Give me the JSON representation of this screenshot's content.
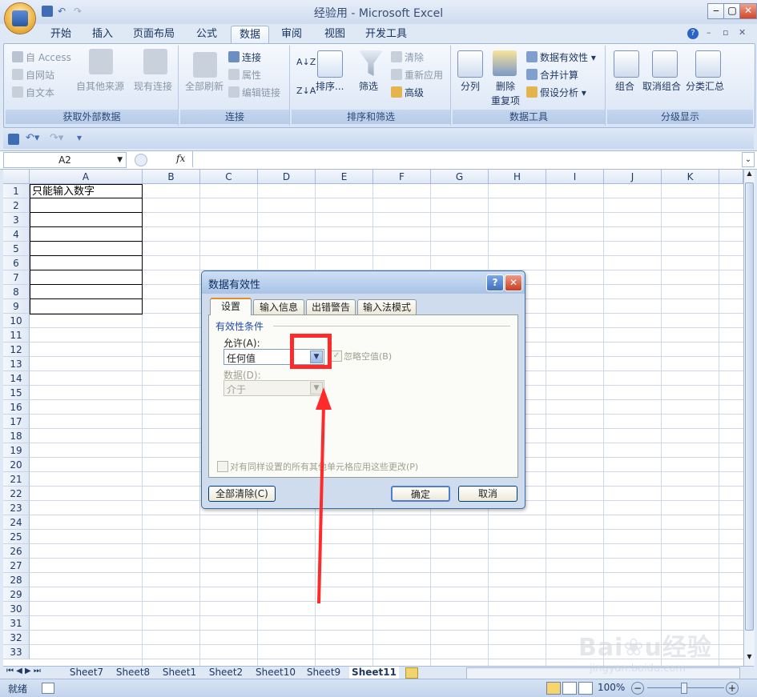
{
  "window": {
    "title": "经验用 - Microsoft Excel"
  },
  "tabs": [
    "开始",
    "插入",
    "页面布局",
    "公式",
    "数据",
    "审阅",
    "视图",
    "开发工具"
  ],
  "active_tab": "数据",
  "ribbon": {
    "get_external": {
      "access": "自 Access",
      "web": "自网站",
      "text": "自文本",
      "other": "自其他来源",
      "existing": "现有连接",
      "label": "获取外部数据"
    },
    "connections": {
      "refresh": "全部刷新",
      "connect": "连接",
      "props": "属性",
      "edit_links": "编辑链接",
      "label": "连接"
    },
    "sort_filter": {
      "sort": "排序...",
      "filter": "筛选",
      "clear": "清除",
      "reapply": "重新应用",
      "advanced": "高级",
      "label": "排序和筛选"
    },
    "data_tools": {
      "split": "分列",
      "remove_dup_1": "删除",
      "remove_dup_2": "重复项",
      "validation": "数据有效性",
      "consolidate": "合并计算",
      "whatif": "假设分析",
      "label": "数据工具"
    },
    "outline": {
      "group": "组合",
      "ungroup": "取消组合",
      "subtotal": "分类汇总",
      "label": "分级显示"
    }
  },
  "formula_bar": {
    "name_box": "A2",
    "fx": "fx"
  },
  "columns": [
    "A",
    "B",
    "C",
    "D",
    "E",
    "F",
    "G",
    "H",
    "I",
    "J",
    "K"
  ],
  "rows": [
    "1",
    "2",
    "3",
    "4",
    "5",
    "6",
    "7",
    "8",
    "9",
    "10",
    "11",
    "12",
    "13",
    "14",
    "15",
    "16",
    "17",
    "18",
    "19",
    "20",
    "21",
    "22",
    "23",
    "24",
    "25",
    "26",
    "27",
    "28",
    "29",
    "30",
    "31",
    "32",
    "33"
  ],
  "cells": {
    "A1": "只能输入数字"
  },
  "sheets": [
    "Sheet7",
    "Sheet8",
    "Sheet1",
    "Sheet2",
    "Sheet10",
    "Sheet9",
    "Sheet11"
  ],
  "active_sheet": "Sheet11",
  "status": {
    "ready": "就绪",
    "zoom": "100%"
  },
  "dialog": {
    "title": "数据有效性",
    "tabs": [
      "设置",
      "输入信息",
      "出错警告",
      "输入法模式"
    ],
    "section": "有效性条件",
    "allow_label": "允许(A):",
    "allow_value": "任何值",
    "ignore_blank": "忽略空值(B)",
    "data_label": "数据(D):",
    "data_value": "介于",
    "apply_all": "对有同样设置的所有其他单元格应用这些更改(P)",
    "clear_all": "全部清除(C)",
    "ok": "确定",
    "cancel": "取消"
  },
  "watermark": "Baidu经验 jingyan.baidu.com",
  "colors": {
    "annotation": "#ff2a2a",
    "ribbon_bg": "#dfe8f5",
    "dialog_tab_accent": "#e68b2c"
  }
}
